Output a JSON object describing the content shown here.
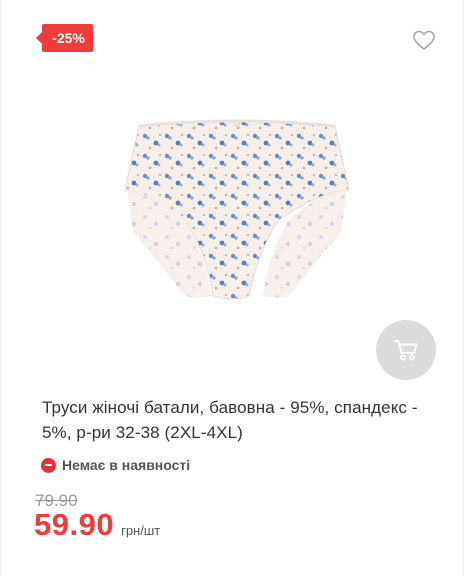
{
  "badge": {
    "discount": "-25%"
  },
  "icons": {
    "favorite": "heart-outline-icon",
    "cart": "cart-icon",
    "stock": "minus-circle-icon"
  },
  "product": {
    "title": "Труси жіночі батали, бавовна - 95%, спандекс - 5%, р-ри 32-38 (2XL-4XL)",
    "stock_status": "Немає в наявності",
    "old_price": "79.90",
    "price": "59.90",
    "unit": "грн/шт"
  },
  "colors": {
    "accent": "#ef3d3d",
    "cart_button": "#dcdcdc",
    "text": "#333333"
  }
}
